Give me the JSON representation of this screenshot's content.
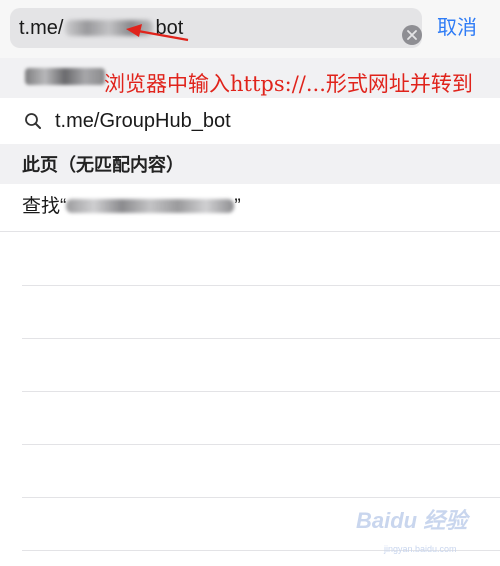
{
  "address_bar": {
    "url_prefix": "t.me/",
    "url_suffix": "bot",
    "cancel_label": "取消"
  },
  "suggestion": {
    "text": "t.me/GroupHub_bot"
  },
  "section": {
    "title": "此页（无匹配内容）"
  },
  "find_row": {
    "prefix": "查找“",
    "suffix": "”"
  },
  "annotation": {
    "text": "浏览器中输入https://...形式网址并转到"
  },
  "watermark": {
    "text": "Baidu 经验",
    "sub": "jingyan.baidu.com"
  },
  "colors": {
    "accent": "#2f7cf6",
    "annotation": "#e0231b"
  },
  "icons": [
    "clear-icon",
    "search-icon",
    "arrow-icon"
  ]
}
